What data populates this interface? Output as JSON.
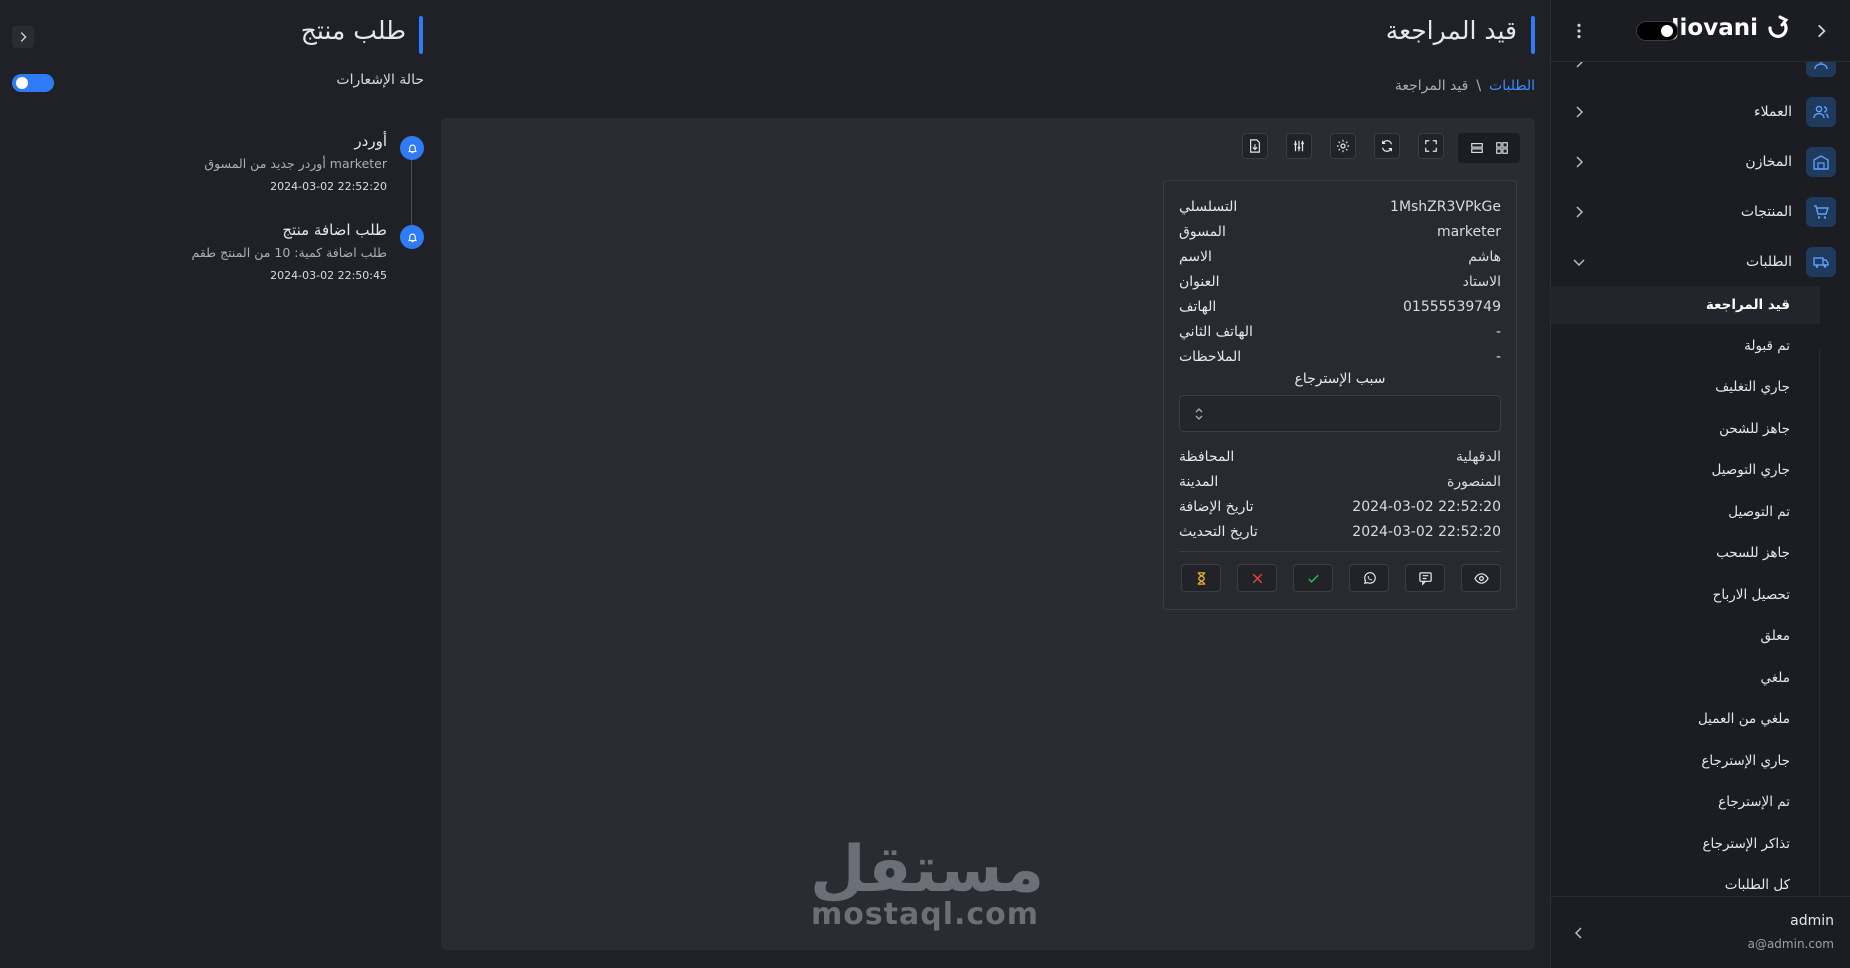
{
  "sidebar": {
    "brand": "Jiovani",
    "items": [
      {
        "label": "",
        "icon": "user-tie-icon"
      },
      {
        "label": "العملاء",
        "icon": "users-icon"
      },
      {
        "label": "المخازن",
        "icon": "warehouse-icon"
      },
      {
        "label": "المنتجات",
        "icon": "cart-icon"
      },
      {
        "label": "الطلبات",
        "icon": "truck-icon"
      }
    ],
    "submenu": [
      "قيد المراجعة",
      "تم قبولة",
      "جاري التغليف",
      "جاهز للشحن",
      "جاري التوصيل",
      "تم التوصيل",
      "جاهز للسحب",
      "تحصيل الارباح",
      "معلق",
      "ملغي",
      "ملغي من العميل",
      "جاري الإسترجاع",
      "تم الإسترجاع",
      "تذاكر الإسترجاع",
      "كل الطلبات"
    ],
    "user": {
      "name": "admin",
      "email": "a@admin.com"
    }
  },
  "main": {
    "title": "قيد المراجعة",
    "breadcrumb": {
      "parent": "الطلبات",
      "separator": "\\",
      "current": "قيد المراجعة"
    }
  },
  "order_card": {
    "rows_top": [
      {
        "key": "التسلسلي",
        "value": "1MshZR3VPkGe"
      },
      {
        "key": "المسوق",
        "value": "marketer"
      },
      {
        "key": "الاسم",
        "value": "هاشم"
      },
      {
        "key": "العنوان",
        "value": "الاستاد"
      },
      {
        "key": "الهاتف",
        "value": "01555539749"
      },
      {
        "key": "الهاتف الثاني",
        "value": "-"
      },
      {
        "key": "الملاحظات",
        "value": "-"
      }
    ],
    "return_reason_label": "سبب الإسترجاع",
    "return_reason_value": "",
    "rows_bottom": [
      {
        "key": "المحافظة",
        "value": "الدقهلية"
      },
      {
        "key": "المدينة",
        "value": "المنصورة"
      },
      {
        "key": "تاريخ الإضافة",
        "value": "2024-03-02 22:52:20"
      },
      {
        "key": "تاريخ التحديث",
        "value": "2024-03-02 22:52:20"
      }
    ],
    "action_colors": {
      "pending": "#e6b422",
      "reject": "#e0443a",
      "accept": "#36b24a"
    }
  },
  "notifications": {
    "title": "طلب منتج",
    "status_label": "حالة الإشعارات",
    "enabled": true,
    "items": [
      {
        "title": "أوردر",
        "desc": "أوردر جديد من المسوق marketer",
        "time": "2024-03-02 22:52:20"
      },
      {
        "title": "طلب اضافة منتج",
        "desc": "طلب اضافة كمية: 10 من المنتج طقم",
        "time": "2024-03-02 22:50:45"
      }
    ]
  },
  "watermark": {
    "arabic": "مستقل",
    "latin": "mostaql.com"
  },
  "colors": {
    "accent": "#2f7bf5",
    "link": "#3a8cff"
  }
}
